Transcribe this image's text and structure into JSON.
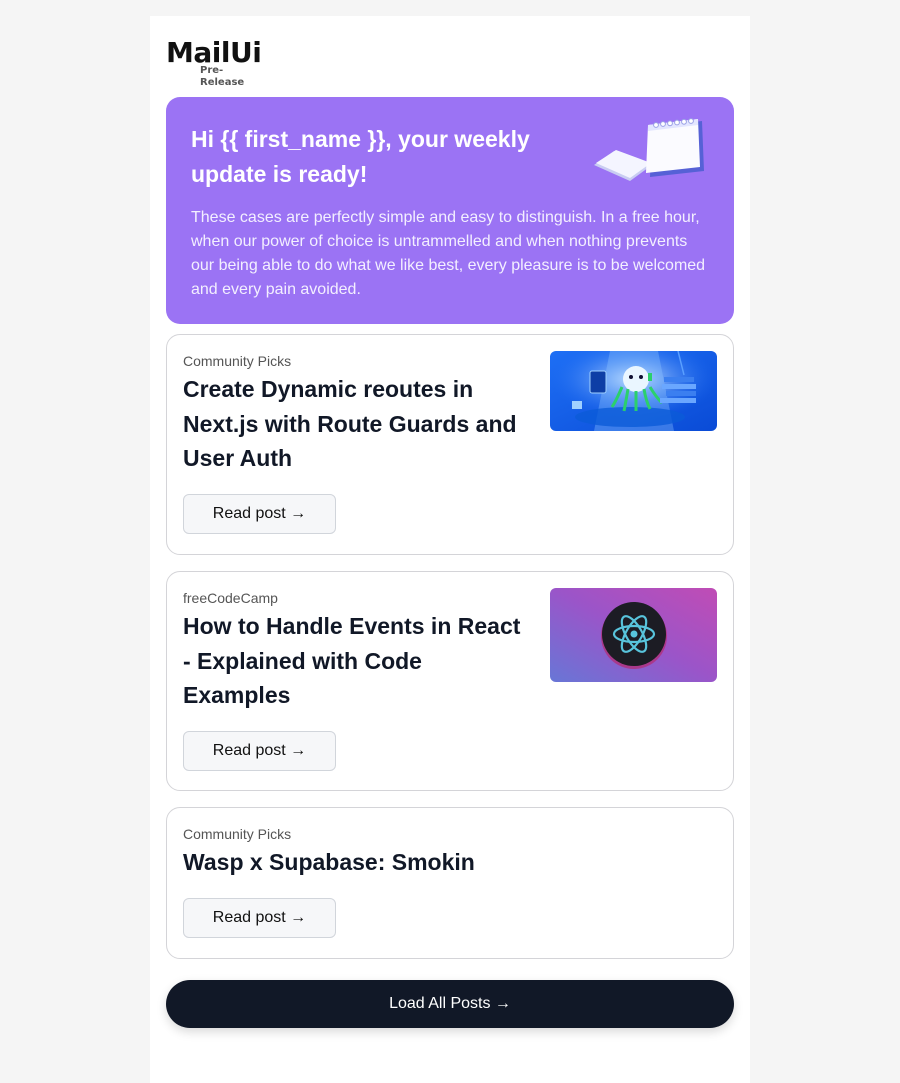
{
  "brand": {
    "name": "MailUi",
    "tag": "Pre-Release"
  },
  "hero": {
    "title": "Hi {{ first_name }}, your weekly update is ready!",
    "text": "These cases are perfectly simple and easy to distinguish. In a free hour, when our power of choice is untrammelled and when nothing prevents our being able to do what we like best, every pleasure is to be welcomed and every pain avoided.",
    "illustration": "calendar-notepad-illustration",
    "background": "#9b73f4"
  },
  "posts": [
    {
      "source": "Community Picks",
      "title": "Create Dynamic reoutes in Next.js with Route Guards and User Auth",
      "button": "Read post →",
      "thumbnail": "octopus-desk-illustration"
    },
    {
      "source": "freeCodeCamp",
      "title": "How to Handle Events in React - Explained with Code Examples",
      "button": "Read post →",
      "thumbnail": "react-logo-illustration"
    },
    {
      "source": "Community Picks",
      "title": "Wasp x Supabase: Smokin",
      "button": "Read post →"
    }
  ],
  "footer": {
    "load_all": "Load All Posts →"
  },
  "colors": {
    "page_bg": "#f5f5f5",
    "hero": "#9b73f4",
    "dark_button": "#111827",
    "card_border": "#d4d4d8"
  }
}
